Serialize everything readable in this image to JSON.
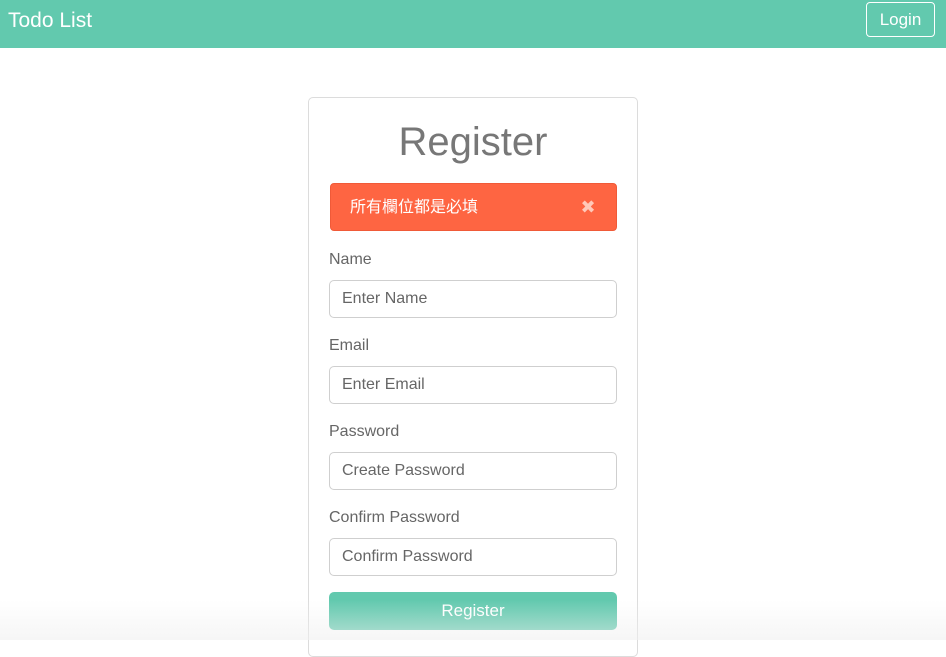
{
  "navbar": {
    "brand": "Todo List",
    "login_label": "Login"
  },
  "form": {
    "title": "Register",
    "alert": {
      "message": "所有欄位都是必填",
      "close_glyph": "✖"
    },
    "fields": [
      {
        "label": "Name",
        "placeholder": "Enter Name",
        "value": ""
      },
      {
        "label": "Email",
        "placeholder": "Enter Email",
        "value": ""
      },
      {
        "label": "Password",
        "placeholder": "Create Password",
        "value": ""
      },
      {
        "label": "Confirm Password",
        "placeholder": "Confirm Password",
        "value": ""
      }
    ],
    "submit_label": "Register"
  },
  "colors": {
    "brand": "#62c9ae",
    "alert": "#fe6542"
  }
}
